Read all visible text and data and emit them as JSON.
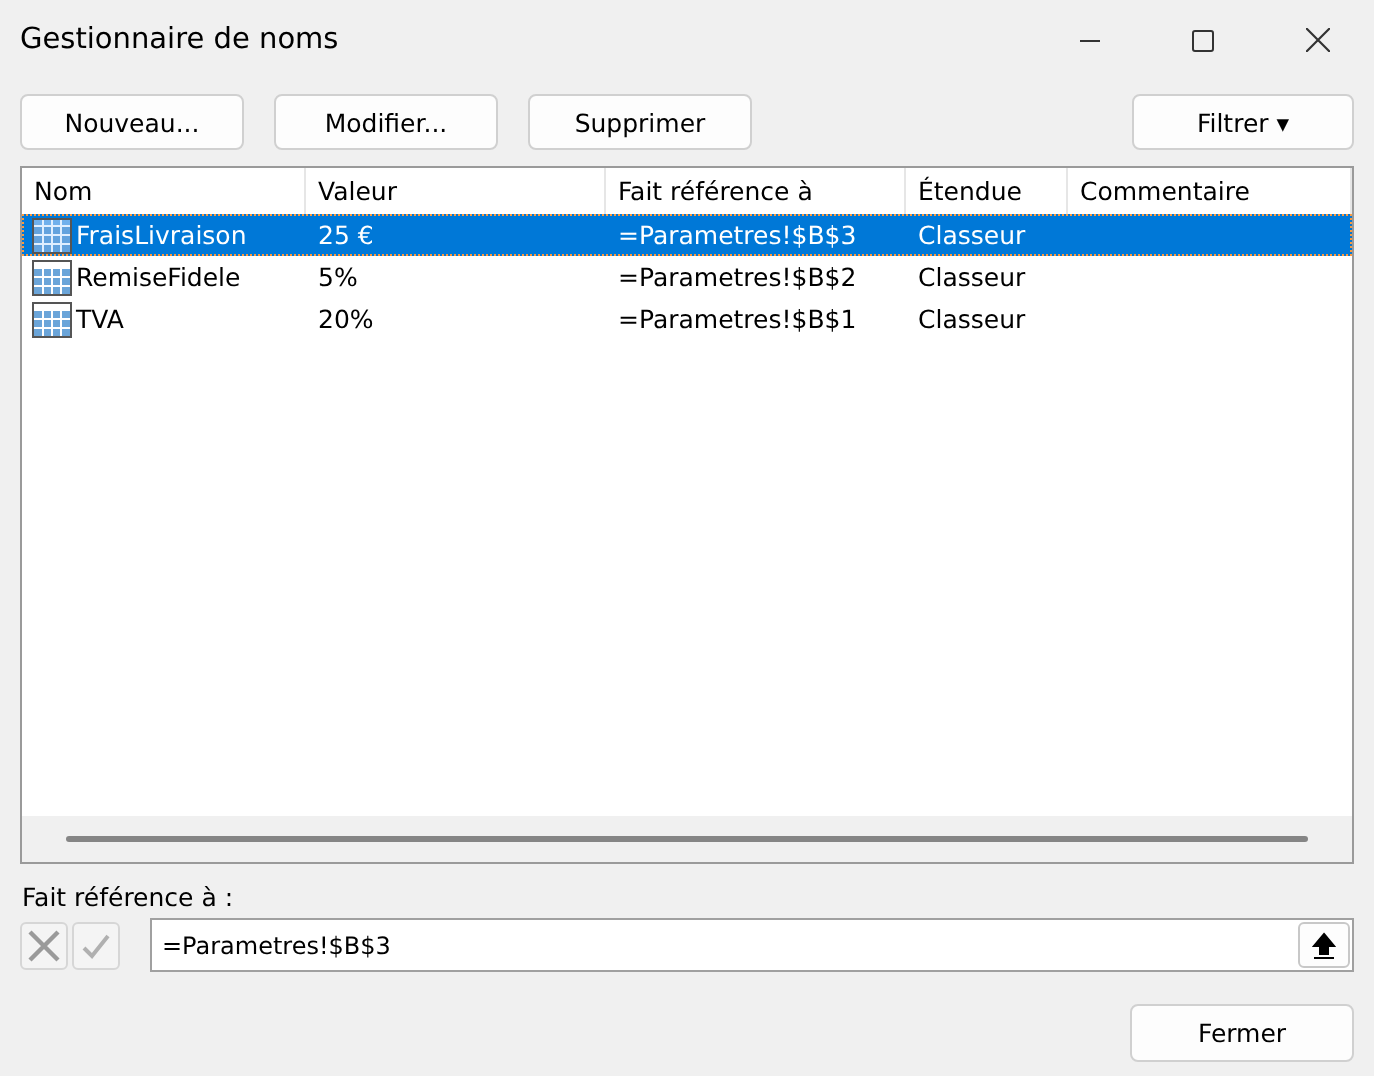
{
  "window": {
    "title": "Gestionnaire de noms"
  },
  "buttons": [
    "Nouveau...",
    "Modifier...",
    "Supprimer"
  ],
  "filter_button": {
    "label": "Filtrer",
    "arrow": "▾"
  },
  "table": {
    "columns": [
      "Nom",
      "Valeur",
      "Fait référence à",
      "Étendue",
      "Commentaire"
    ],
    "rows": [
      {
        "cells": [
          "FraisLivraison",
          "25 €",
          "=Parametres!$B$3",
          "Classeur",
          ""
        ],
        "selected": true
      },
      {
        "cells": [
          "RemiseFidele",
          "5%",
          "=Parametres!$B$2",
          "Classeur",
          ""
        ],
        "selected": false
      },
      {
        "cells": [
          "TVA",
          "20%",
          "=Parametres!$B$1",
          "Classeur",
          ""
        ],
        "selected": false
      }
    ]
  },
  "reference": {
    "label": "Fait référence à :",
    "value": "=Parametres!$B$3"
  },
  "close_button": "Fermer"
}
